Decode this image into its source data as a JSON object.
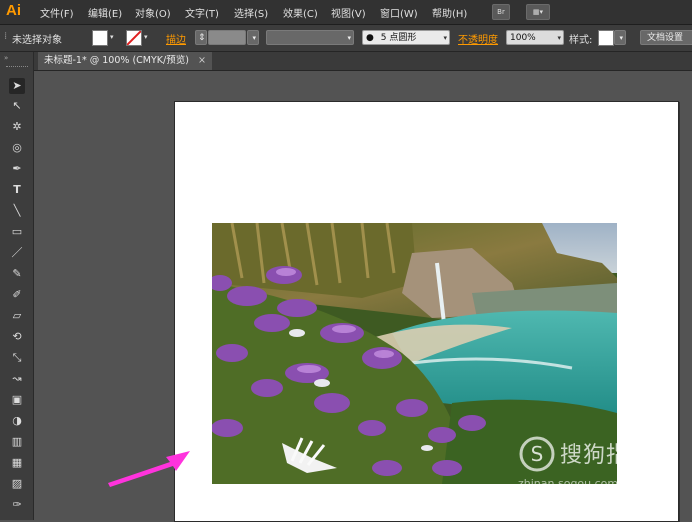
{
  "app": {
    "logo": "Ai"
  },
  "menu": {
    "items": [
      "文件(F)",
      "编辑(E)",
      "对象(O)",
      "文字(T)",
      "选择(S)",
      "效果(C)",
      "视图(V)",
      "窗口(W)",
      "帮助(H)"
    ],
    "bridge_icon": "Br",
    "arrange_icon": "▦▾"
  },
  "control": {
    "selection_label": "未选择对象",
    "stroke_label": "描边",
    "brush_label": "5 点圆形",
    "opacity_label": "不透明度",
    "opacity_value": "100%",
    "style_label": "样式:",
    "doc_settings": "文档设置"
  },
  "document": {
    "tab_title": "未标题-1* @ 100% (CMYK/预览)",
    "close": "×"
  },
  "tools": [
    "➤",
    "↖",
    "✲",
    "◎",
    "✒",
    "T",
    "╲",
    "▭",
    "／",
    "✎",
    "✐",
    "▱",
    "⟲",
    "⤡",
    "↝",
    "▣",
    "◑",
    "▥",
    "▦",
    "▨",
    "◧",
    "✑"
  ],
  "watermark": {
    "text": "搜狗指南",
    "url": "zhinan.sogou.com"
  },
  "colors": {
    "accent": "#ff9a00",
    "arrow": "#ff33dd"
  }
}
